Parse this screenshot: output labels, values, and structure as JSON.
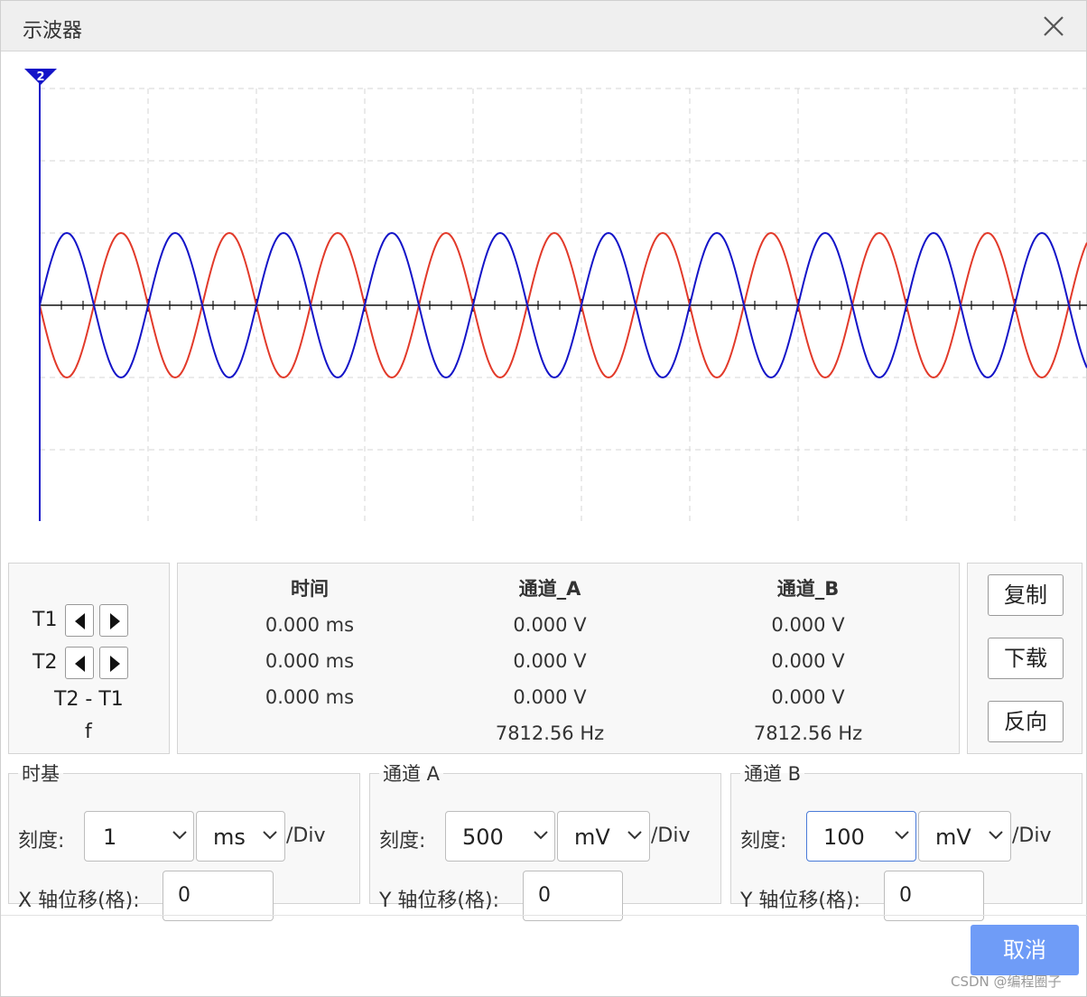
{
  "window": {
    "title": "示波器"
  },
  "scope": {
    "trigger_marker": "2",
    "channel_a_color": "#e23a2a",
    "channel_b_color": "#1414c8",
    "grid_color": "#d4d4d4"
  },
  "cursors": {
    "t1": "T1",
    "t2": "T2",
    "delta": "T2 - T1",
    "freq": "f"
  },
  "measurements": {
    "headers": [
      "时间",
      "通道_A",
      "通道_B"
    ],
    "rows": [
      [
        "0.000 ms",
        "0.000 V",
        "0.000 V"
      ],
      [
        "0.000 ms",
        "0.000 V",
        "0.000 V"
      ],
      [
        "0.000 ms",
        "0.000 V",
        "0.000 V"
      ],
      [
        "",
        "7812.56 Hz",
        "7812.56 Hz"
      ]
    ]
  },
  "actions": {
    "copy": "复制",
    "download": "下载",
    "invert": "反向"
  },
  "timebase": {
    "legend": "时基",
    "scale_label": "刻度:",
    "scale_value": "1",
    "unit": "ms",
    "per_div": "/Div",
    "offset_label": "X 轴位移(格):",
    "offset_value": "0"
  },
  "channel_a": {
    "legend": "通道 A",
    "scale_label": "刻度:",
    "scale_value": "500",
    "unit": "mV",
    "per_div": "/Div",
    "offset_label": "Y 轴位移(格):",
    "offset_value": "0"
  },
  "channel_b": {
    "legend": "通道 B",
    "scale_label": "刻度:",
    "scale_value": "100",
    "unit": "mV",
    "per_div": "/Div",
    "offset_label": "Y 轴位移(格):",
    "offset_value": "0"
  },
  "footer": {
    "cancel": "取消",
    "watermark": "CSDN @编程圈子"
  }
}
